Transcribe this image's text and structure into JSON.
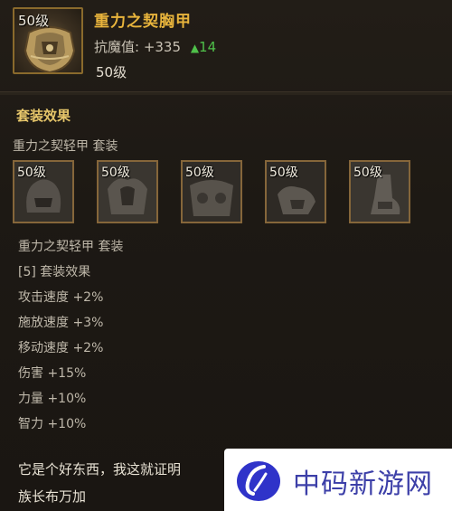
{
  "item": {
    "level_badge": "50级",
    "name": "重力之契胸甲",
    "stat_label": "抗魔值: +335",
    "stat_increase": "14",
    "level_text": "50级"
  },
  "set": {
    "header": "套装效果",
    "name": "重力之契轻甲 套装",
    "pieces": [
      {
        "level": "50级"
      },
      {
        "level": "50级"
      },
      {
        "level": "50级"
      },
      {
        "level": "50级"
      },
      {
        "level": "50级"
      }
    ],
    "bonus_lines": [
      "重力之契轻甲 套装",
      "[5] 套装效果",
      "攻击速度 +2%",
      "施放速度 +3%",
      "移动速度 +2%",
      "伤害 +15%",
      "力量 +10%",
      "智力 +10%"
    ]
  },
  "flavor": {
    "line1": "它是个好东西，我这就证明",
    "line2": "族长布万加"
  },
  "watermark": {
    "text": "中码新游网"
  },
  "colors": {
    "title": "#e8b43c",
    "increase": "#4fc04a",
    "slot_border": "#85663a",
    "watermark_blue": "#3c3fa8"
  }
}
